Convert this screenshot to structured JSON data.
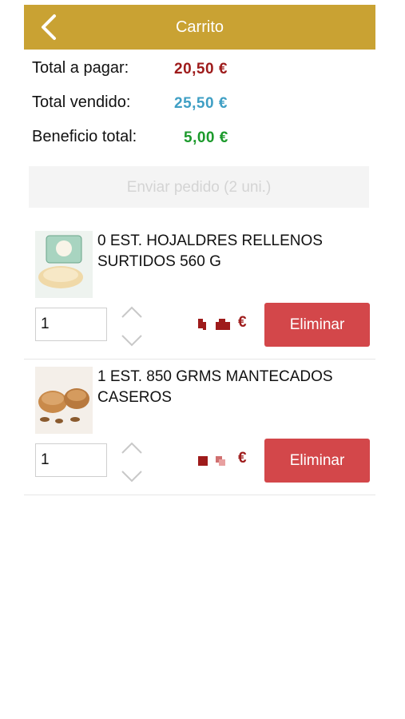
{
  "header": {
    "title": "Carrito",
    "back_icon": "chevron-left-icon",
    "color": "#c9a233"
  },
  "totals": {
    "pay_label": "Total a pagar:",
    "pay_value": "20,50 €",
    "sold_label": "Total vendido:",
    "sold_value": "25,50 €",
    "profit_label": "Beneficio total:",
    "profit_value": "5,00 €"
  },
  "send_button": {
    "label": "Enviar pedido (2 uni.)"
  },
  "items": [
    {
      "name": "0 EST. HOJALDRES RELLENOS SURTIDOS 560 G",
      "quantity": "1",
      "currency": "€",
      "delete_label": "Eliminar"
    },
    {
      "name": "1 EST. 850 GRMS MANTECADOS CASEROS",
      "quantity": "1",
      "currency": "€",
      "delete_label": "Eliminar"
    }
  ],
  "colors": {
    "delete": "#d3474a",
    "pay": "#9e1b1b",
    "sold": "#3f9fc4",
    "profit": "#1c9a2c"
  }
}
